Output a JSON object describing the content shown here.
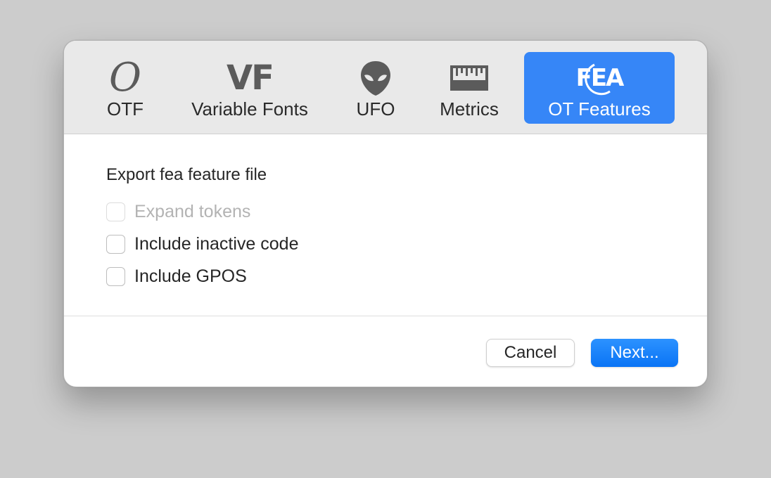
{
  "toolbar": {
    "tabs": [
      {
        "label": "OTF",
        "icon": "otf-icon"
      },
      {
        "label": "Variable Fonts",
        "icon": "vf-icon",
        "icon_text": "VF"
      },
      {
        "label": "UFO",
        "icon": "alien-icon"
      },
      {
        "label": "Metrics",
        "icon": "ruler-icon"
      },
      {
        "label": "OT Features",
        "icon": "fea-icon",
        "icon_text": "FEA",
        "selected": true
      }
    ],
    "otf_glyph": "O"
  },
  "content": {
    "heading": "Export fea feature file",
    "options": [
      {
        "label": "Expand tokens",
        "checked": false,
        "enabled": false
      },
      {
        "label": "Include inactive code",
        "checked": false,
        "enabled": true
      },
      {
        "label": "Include GPOS",
        "checked": false,
        "enabled": true
      }
    ]
  },
  "buttons": {
    "cancel_label": "Cancel",
    "next_label": "Next..."
  },
  "colors": {
    "accent": "#3686f7",
    "toolbar_bg": "#e9e9e9",
    "backdrop": "#cccccc"
  }
}
